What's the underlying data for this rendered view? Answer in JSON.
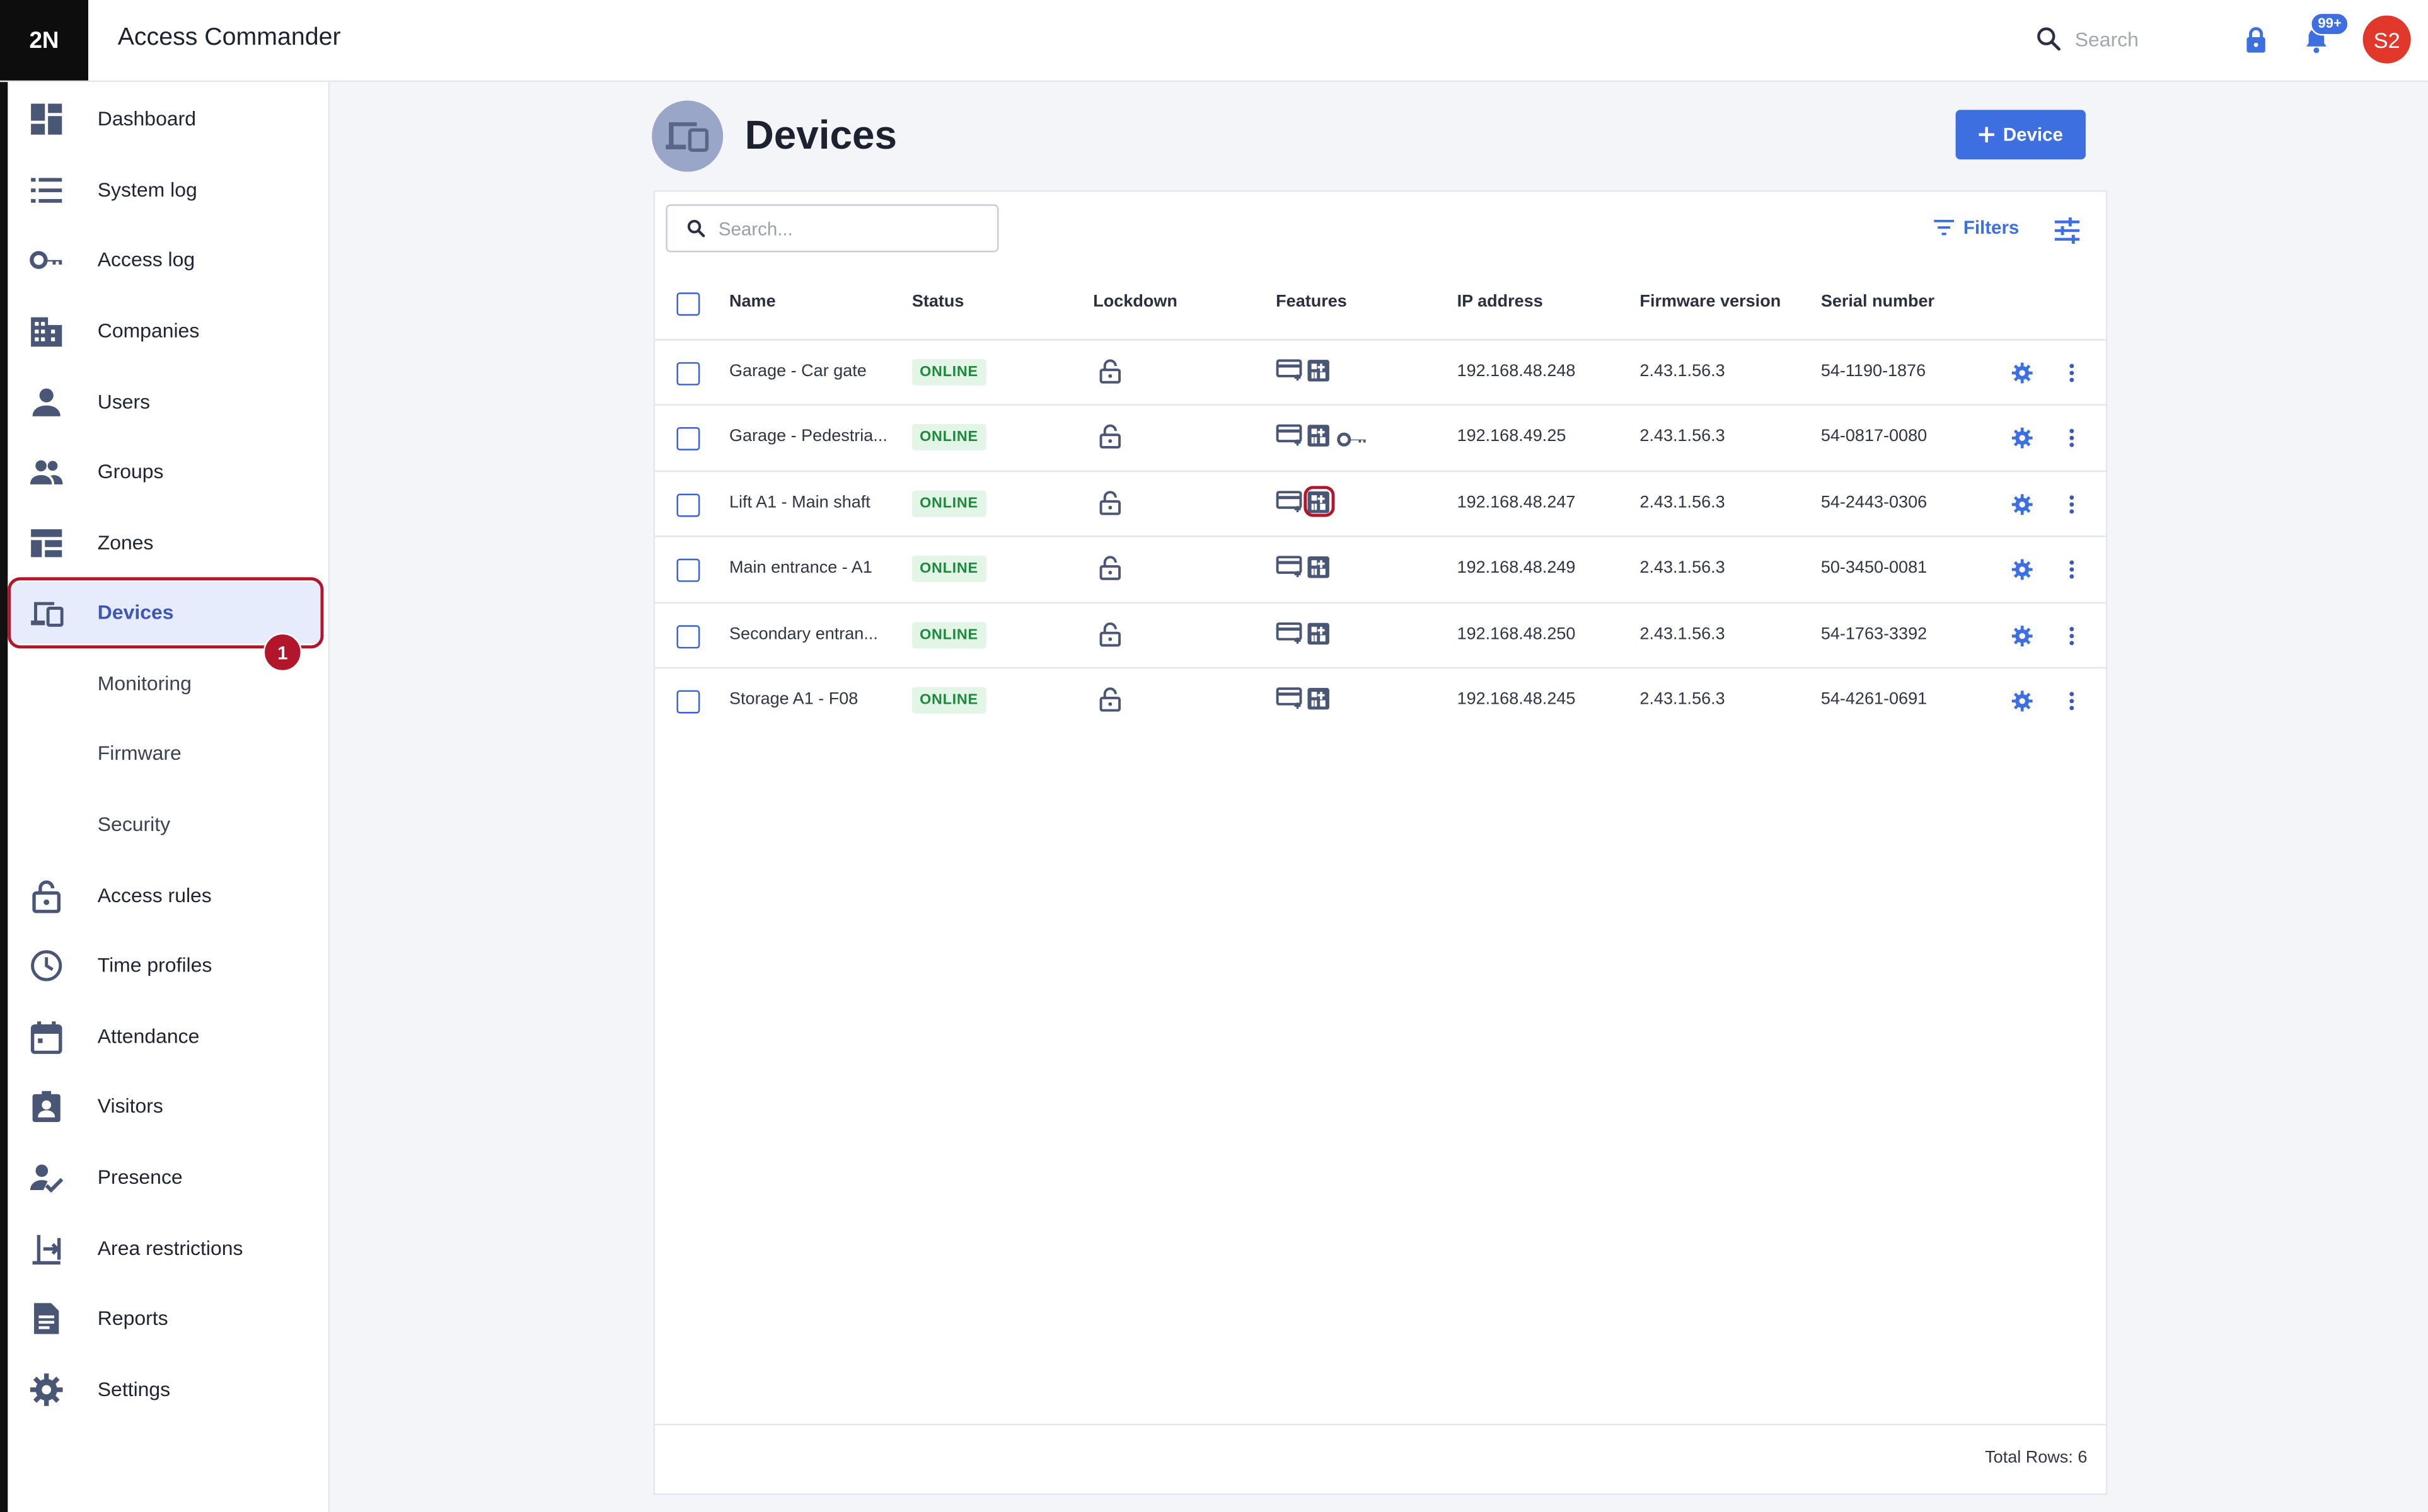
{
  "app": {
    "logo": "2N",
    "title": "Access Commander",
    "search_placeholder": "Search",
    "notifications_badge": "99+",
    "user_initials": "S2"
  },
  "sidebar": {
    "items": [
      {
        "label": "Dashboard",
        "icon": "dashboard-icon"
      },
      {
        "label": "System log",
        "icon": "list-icon"
      },
      {
        "label": "Access log",
        "icon": "key-icon"
      },
      {
        "label": "Companies",
        "icon": "building-icon"
      },
      {
        "label": "Users",
        "icon": "user-icon"
      },
      {
        "label": "Groups",
        "icon": "group-icon"
      },
      {
        "label": "Zones",
        "icon": "zones-icon"
      },
      {
        "label": "Devices",
        "icon": "devices-icon",
        "active": true
      },
      {
        "label": "Monitoring",
        "sub": true
      },
      {
        "label": "Firmware",
        "sub": true
      },
      {
        "label": "Security",
        "sub": true
      },
      {
        "label": "Access rules",
        "icon": "lock-icon"
      },
      {
        "label": "Time profiles",
        "icon": "clock-icon"
      },
      {
        "label": "Attendance",
        "icon": "calendar-icon"
      },
      {
        "label": "Visitors",
        "icon": "visitor-badge-icon"
      },
      {
        "label": "Presence",
        "icon": "user-check-icon"
      },
      {
        "label": "Area restrictions",
        "icon": "area-restriction-icon"
      },
      {
        "label": "Reports",
        "icon": "report-icon"
      },
      {
        "label": "Settings",
        "icon": "gear-icon"
      }
    ],
    "step_marker": "1"
  },
  "page": {
    "title": "Devices",
    "add_button": "Device",
    "search_placeholder": "Search...",
    "filters_label": "Filters"
  },
  "table": {
    "headers": {
      "name": "Name",
      "status": "Status",
      "lockdown": "Lockdown",
      "features": "Features",
      "ip": "IP address",
      "firmware": "Firmware version",
      "serial": "Serial number"
    },
    "rows": [
      {
        "name": "Garage - Car gate",
        "status": "ONLINE",
        "features": [
          "card",
          "keypad"
        ],
        "ip": "192.168.48.248",
        "firmware": "2.43.1.56.3",
        "serial": "54-1190-1876"
      },
      {
        "name": "Garage - Pedestria...",
        "status": "ONLINE",
        "features": [
          "card",
          "keypad",
          "key"
        ],
        "ip": "192.168.49.25",
        "firmware": "2.43.1.56.3",
        "serial": "54-0817-0080"
      },
      {
        "name": "Lift A1 - Main shaft",
        "status": "ONLINE",
        "features": [
          "card",
          "keypad"
        ],
        "ip": "192.168.48.247",
        "firmware": "2.43.1.56.3",
        "serial": "54-2443-0306"
      },
      {
        "name": "Main entrance - A1",
        "status": "ONLINE",
        "features": [
          "card",
          "keypad"
        ],
        "ip": "192.168.48.249",
        "firmware": "2.43.1.56.3",
        "serial": "50-3450-0081"
      },
      {
        "name": "Secondary entran...",
        "status": "ONLINE",
        "features": [
          "card",
          "keypad"
        ],
        "ip": "192.168.48.250",
        "firmware": "2.43.1.56.3",
        "serial": "54-1763-3392"
      },
      {
        "name": "Storage A1 - F08",
        "status": "ONLINE",
        "features": [
          "card",
          "keypad"
        ],
        "ip": "192.168.48.245",
        "firmware": "2.43.1.56.3",
        "serial": "54-4261-0691"
      }
    ],
    "total_rows": "Total Rows: 6"
  },
  "colors": {
    "brand": "#3d6fe0",
    "status_online": "#1b8a3a",
    "highlight": "#b1162b"
  }
}
